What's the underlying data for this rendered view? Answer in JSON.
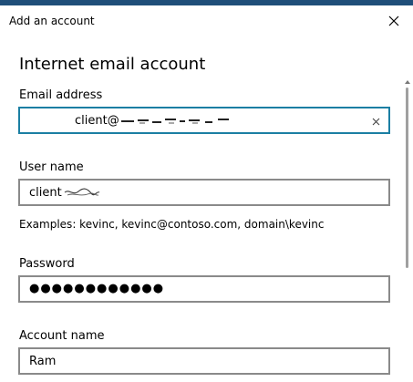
{
  "window": {
    "title": "Add an account",
    "close_icon": "close-icon"
  },
  "form": {
    "heading": "Internet email account",
    "email": {
      "label": "Email address",
      "value": "client@"
    },
    "username": {
      "label": "User name",
      "value": "client"
    },
    "examples": "Examples: kevinc, kevinc@contoso.com, domain\\kevinc",
    "password": {
      "label": "Password",
      "value": "●●●●●●●●●●●●"
    },
    "account_name": {
      "label": "Account name",
      "value": "Ram"
    }
  },
  "colors": {
    "accent_border": "#1b7fa3",
    "field_border": "#8a8a8a",
    "top_strip": "#1f4e79"
  }
}
